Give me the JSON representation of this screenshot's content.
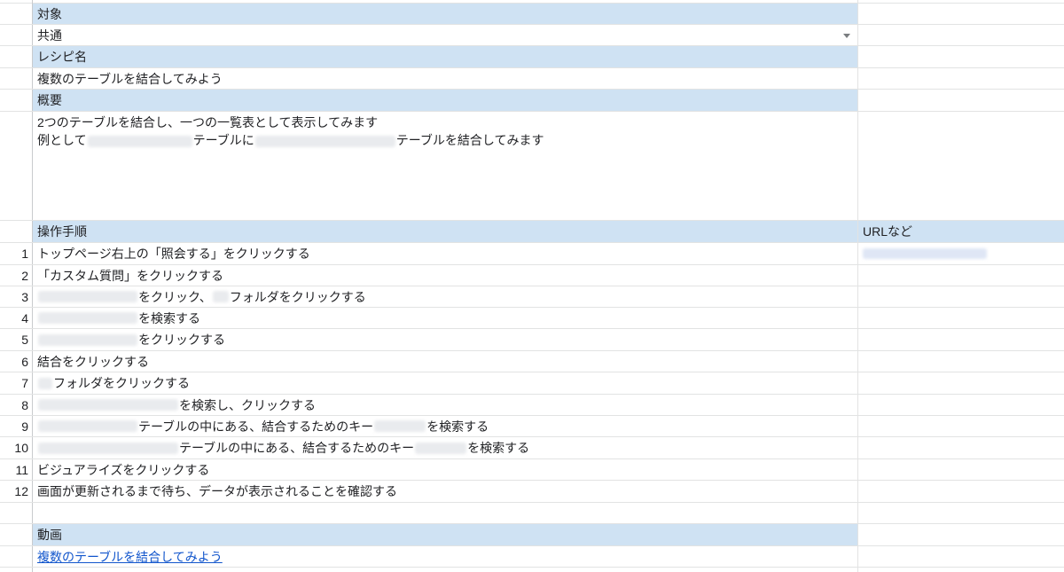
{
  "sections": {
    "target": {
      "header": "対象",
      "value": "共通"
    },
    "recipe_name": {
      "header": "レシピ名",
      "value": "複数のテーブルを結合してみよう"
    },
    "summary": {
      "header": "概要",
      "line1": "2つのテーブルを結合し、一つの一覧表として表示してみます",
      "line2_prefix": "例として",
      "line2_middle": "テーブルに",
      "line2_suffix": "テーブルを結合してみます"
    },
    "steps": {
      "header": "操作手順",
      "url_header": "URLなど",
      "items": [
        {
          "num": "1",
          "text": "トップページ右上の「照会する」をクリックする"
        },
        {
          "num": "2",
          "text": "「カスタム質問」をクリックする"
        },
        {
          "num": "3",
          "text_a": "をクリック、",
          "text_b": "フォルダをクリックする"
        },
        {
          "num": "4",
          "text": "を検索する"
        },
        {
          "num": "5",
          "text": "をクリックする"
        },
        {
          "num": "6",
          "text": "結合をクリックする"
        },
        {
          "num": "7",
          "text": "フォルダをクリックする"
        },
        {
          "num": "8",
          "text": "を検索し、クリックする"
        },
        {
          "num": "9",
          "text_a": "テーブルの中にある、結合するためのキー",
          "text_b": "を検索する"
        },
        {
          "num": "10",
          "text_a": "テーブルの中にある、結合するためのキー",
          "text_b": "を検索する"
        },
        {
          "num": "11",
          "text": "ビジュアライズをクリックする"
        },
        {
          "num": "12",
          "text": "画面が更新されるまで待ち、データが表示されることを確認する"
        }
      ]
    },
    "video": {
      "header": "動画",
      "link_text": "複数のテーブルを結合してみよう"
    }
  },
  "colors": {
    "header_bg": "#cfe2f3",
    "grid_line": "#e2e3e3",
    "link": "#1155cc"
  },
  "icons": {
    "dropdown": "chevron-down-icon"
  }
}
